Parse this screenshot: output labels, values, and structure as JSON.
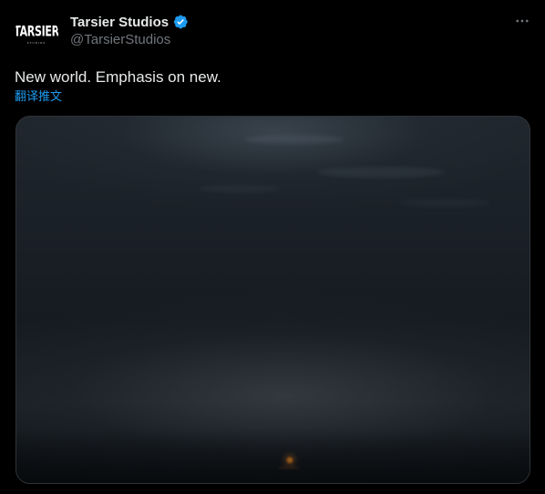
{
  "author": {
    "avatar_text": "TARSIER",
    "avatar_subtext": "STUDIOS",
    "display_name": "Tarsier Studios",
    "handle": "@TarsierStudios",
    "verified": true,
    "verified_icon": "verified-badge-icon",
    "verified_color": "#1d9bf0"
  },
  "menu": {
    "icon": "more-horizontal-icon"
  },
  "tweet": {
    "text": "New world. Emphasis on new.",
    "translate_label": "翻译推文"
  },
  "media": {
    "type": "image",
    "icon": "dark-landscape-image"
  },
  "colors": {
    "background": "#000000",
    "primary_text": "#e7e9ea",
    "secondary_text": "#71767b",
    "link": "#1d9bf0",
    "border": "#2f3336"
  }
}
